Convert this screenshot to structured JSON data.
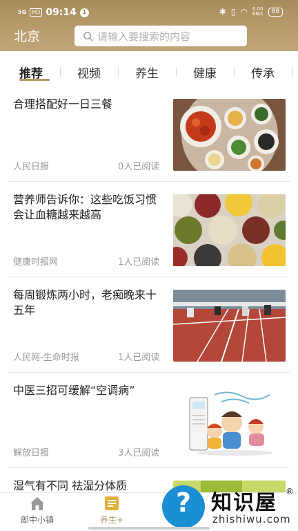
{
  "status_bar": {
    "signal": "5G",
    "hd": "HD",
    "time": "09:14",
    "notification_count": "1",
    "net_speed_value": "0.00",
    "net_speed_unit": "KB/s",
    "battery": "88"
  },
  "header": {
    "city": "北京",
    "search_placeholder": "请输入要搜索的内容"
  },
  "tabs": [
    {
      "label": "推荐",
      "active": true
    },
    {
      "label": "视频",
      "active": false
    },
    {
      "label": "养生",
      "active": false
    },
    {
      "label": "健康",
      "active": false
    },
    {
      "label": "传承",
      "active": false
    }
  ],
  "articles": [
    {
      "title": "合理搭配好一日三餐",
      "source": "人民日报",
      "reads": "0人已阅读",
      "thumb": "meal-photo"
    },
    {
      "title": "营养师告诉你：这些吃饭习惯会让血糖越来越高",
      "source": "健康时报网",
      "reads": "1人已阅读",
      "thumb": "grains-photo"
    },
    {
      "title": "每周锻炼两小时，老痴晚来十五年",
      "source": "人民网-生命时报",
      "reads": "1人已阅读",
      "thumb": "track-photo"
    },
    {
      "title": "中医三招可缓解“空调病”",
      "source": "解放日报",
      "reads": "3人已阅读",
      "thumb": "aircon-illustration"
    },
    {
      "title": "湿气有不同 祛湿分体质",
      "source": "",
      "reads": "",
      "thumb": "green-photo"
    }
  ],
  "bottom_nav": [
    {
      "label": "郎中小镇",
      "icon": "home-icon",
      "active": false
    },
    {
      "label": "养生+",
      "icon": "list-icon",
      "active": true
    }
  ],
  "watermark": {
    "brand": "知识屋",
    "reg": "®",
    "url": "zhishiwu.com",
    "icon": "question-screen-icon"
  },
  "colors": {
    "header_gold": "#b89b6c",
    "accent": "#b8996a",
    "text_gray": "#999999",
    "watermark_blue": "#1a8fd3"
  }
}
